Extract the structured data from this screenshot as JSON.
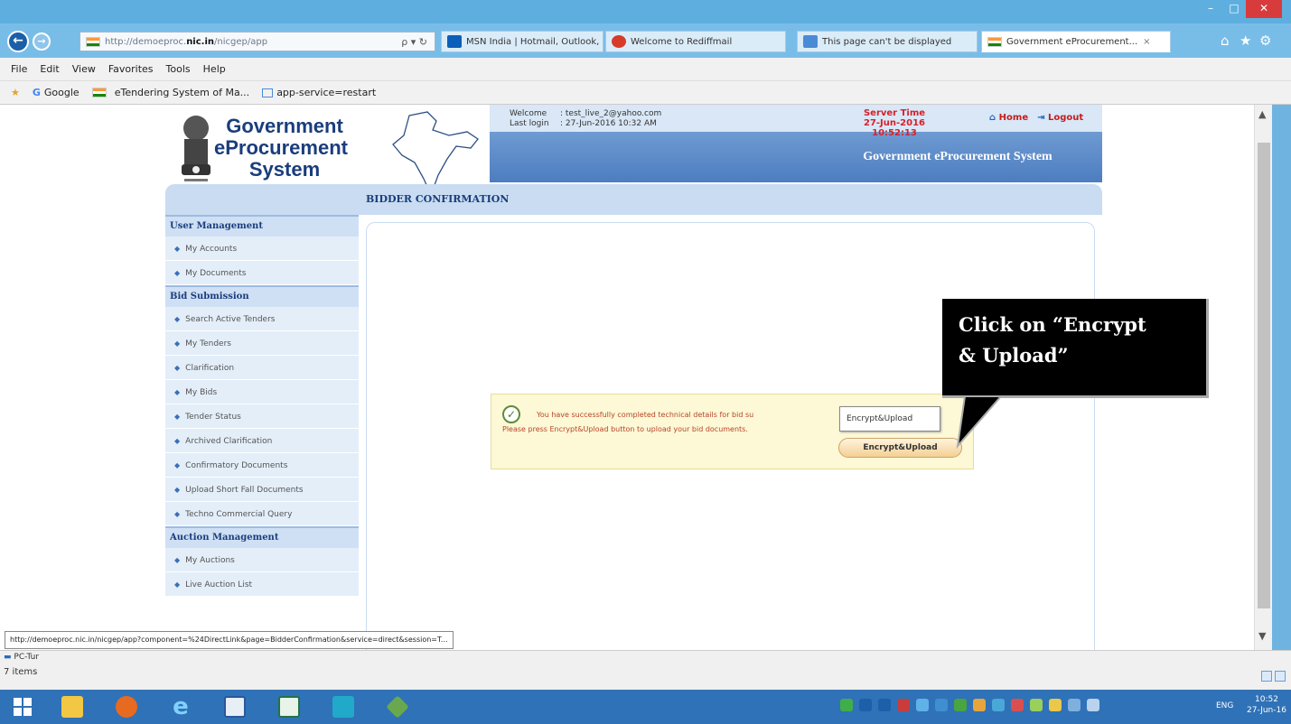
{
  "browser": {
    "address": {
      "prefix": "http://demoeproc.",
      "domain": "nic.in",
      "suffix": "/nicgep/app",
      "icons": "ρ ▾ ↻"
    },
    "tabs": [
      {
        "label": "MSN India | Hotmail, Outlook, ...",
        "color": "#0b5fb8"
      },
      {
        "label": "Welcome to Rediffmail",
        "color": "#d63b2a"
      },
      {
        "label": "This page can't be displayed",
        "color": "#4a8bd6"
      },
      {
        "label": "Government eProcurement...",
        "color": "#ff9933"
      }
    ],
    "menu": [
      "File",
      "Edit",
      "View",
      "Favorites",
      "Tools",
      "Help"
    ],
    "favorites": [
      {
        "label": "Google"
      },
      {
        "label": "eTendering System of Ma..."
      },
      {
        "label": "app-service=restart"
      }
    ]
  },
  "site": {
    "logo_lines": [
      "Government",
      "eProcurement",
      "System"
    ],
    "welcome_label": "Welcome",
    "welcome_value": ": test_live_2@yahoo.com",
    "lastlogin_label": "Last login",
    "lastlogin_value": ": 27-Jun-2016 10:32 AM",
    "server_time_label": "Server Time",
    "server_time_value": "27-Jun-2016 10:52:13",
    "home": "Home",
    "logout": "Logout",
    "system_title": "Government eProcurement System",
    "page_title": "BIDDER CONFIRMATION"
  },
  "sidebar": [
    {
      "type": "head",
      "label": "User Management"
    },
    {
      "type": "item",
      "label": "My Accounts"
    },
    {
      "type": "item",
      "label": "My Documents"
    },
    {
      "type": "head",
      "label": "Bid Submission"
    },
    {
      "type": "item",
      "label": "Search Active Tenders"
    },
    {
      "type": "item",
      "label": "My Tenders"
    },
    {
      "type": "item",
      "label": "Clarification"
    },
    {
      "type": "item",
      "label": "My Bids"
    },
    {
      "type": "item",
      "label": "Tender Status"
    },
    {
      "type": "item",
      "label": "Archived Clarification"
    },
    {
      "type": "item",
      "label": "Confirmatory Documents"
    },
    {
      "type": "item",
      "label": "Upload Short Fall Documents"
    },
    {
      "type": "item",
      "label": "Techno Commercial Query"
    },
    {
      "type": "head",
      "label": "Auction Management"
    },
    {
      "type": "item",
      "label": "My Auctions"
    },
    {
      "type": "item",
      "label": "Live Auction List"
    }
  ],
  "message": {
    "line1": "You have successfully completed technical details for bid su",
    "line2": "Please press Encrypt&Upload button to upload your bid documents.",
    "tooltip": "Encrypt&Upload",
    "button": "Encrypt&Upload"
  },
  "callout": {
    "line1": "Click on “Encrypt",
    "line2": "& Upload”"
  },
  "statusbar": {
    "hover_url": "http://demoeproc.nic.in/nicgep/app?component=%24DirectLink&page=BidderConfirmation&service=direct&session=T...",
    "pc_item": "PC-Tur",
    "item_count": "7 items"
  },
  "taskbar": {
    "lang": "ENG",
    "time": "10:52",
    "date": "27-Jun-16"
  }
}
